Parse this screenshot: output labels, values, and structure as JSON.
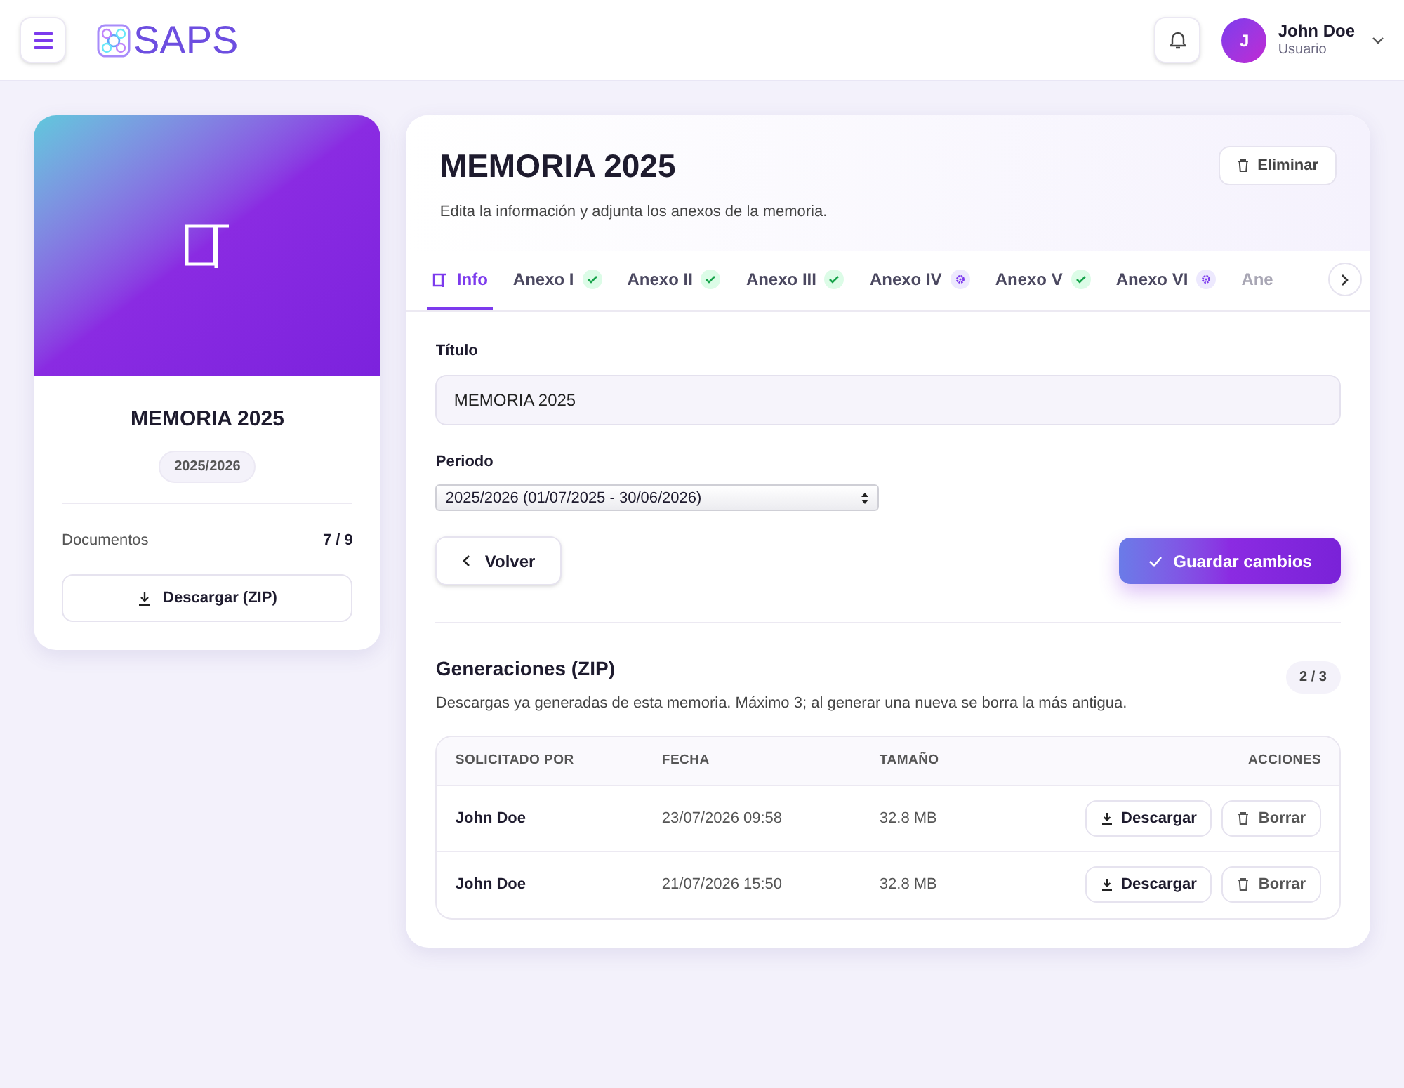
{
  "header": {
    "logo": "SAPS",
    "user": {
      "initial": "J",
      "name": "John Doe",
      "role": "Usuario"
    }
  },
  "summary_card": {
    "title": "MEMORIA 2025",
    "period_badge": "2025/2026",
    "documents_label": "Documentos",
    "documents_value": "7 / 9",
    "download_button": "Descargar (ZIP)"
  },
  "page": {
    "title": "MEMORIA 2025",
    "subtitle": "Edita la información y adjunta los anexos de la memoria.",
    "delete_button": "Eliminar"
  },
  "tabs": [
    {
      "label": "Info",
      "selected": true,
      "kind": "info"
    },
    {
      "label": "Anexo I",
      "selected": false,
      "kind": "done"
    },
    {
      "label": "Anexo II",
      "selected": false,
      "kind": "done"
    },
    {
      "label": "Anexo III",
      "selected": false,
      "kind": "done"
    },
    {
      "label": "Anexo IV",
      "selected": false,
      "kind": "pending"
    },
    {
      "label": "Anexo V",
      "selected": false,
      "kind": "done"
    },
    {
      "label": "Anexo VI",
      "selected": false,
      "kind": "pending"
    },
    {
      "label": "Ane",
      "selected": false,
      "kind": "cut"
    }
  ],
  "form": {
    "title_label": "Título",
    "title_value": "MEMORIA 2025",
    "period_label": "Periodo",
    "period_value": "2025/2026 (01/07/2025 - 30/06/2026)",
    "back_button": "Volver",
    "save_button": "Guardar cambios"
  },
  "generations": {
    "title": "Generaciones (ZIP)",
    "description": "Descargas ya generadas de esta memoria. Máximo 3; al generar una nueva se borra la más antigua.",
    "count_badge": "2 / 3",
    "columns": [
      "SOLICITADO POR",
      "FECHA",
      "TAMAÑO",
      "ACCIONES"
    ],
    "rows": [
      {
        "requested_by": "John Doe",
        "date": "23/07/2026 09:58",
        "size": "32.8 MB",
        "download": "Descargar",
        "delete": "Borrar"
      },
      {
        "requested_by": "John Doe",
        "date": "21/07/2026 15:50",
        "size": "32.8 MB",
        "download": "Descargar",
        "delete": "Borrar"
      }
    ]
  }
}
